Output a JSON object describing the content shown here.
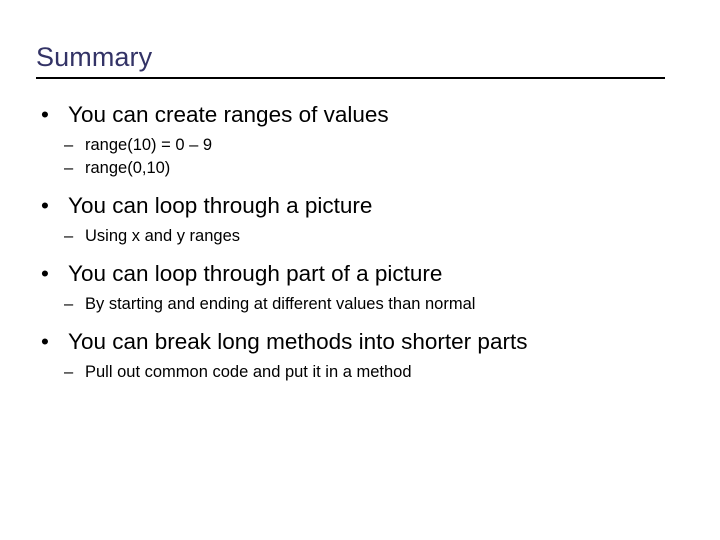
{
  "slide": {
    "title": "Summary",
    "title_color": "#333366",
    "rule_color": "#000000",
    "background": "#ffffff",
    "text_color": "#000000",
    "bullet_marker": "•",
    "sub_bullet_marker": "–",
    "groups": [
      {
        "bullet": "You can create ranges of values",
        "sub_bullets": [
          "range(10) = 0 – 9",
          "range(0,10)"
        ]
      },
      {
        "bullet": "You can loop through a picture",
        "sub_bullets": [
          "Using x and y ranges"
        ]
      },
      {
        "bullet": "You can loop through part of a picture",
        "sub_bullets": [
          "By starting and ending at different values than normal"
        ]
      },
      {
        "bullet": "You can break long methods into shorter parts",
        "sub_bullets": [
          "Pull out common code and put it in a method"
        ]
      }
    ]
  }
}
